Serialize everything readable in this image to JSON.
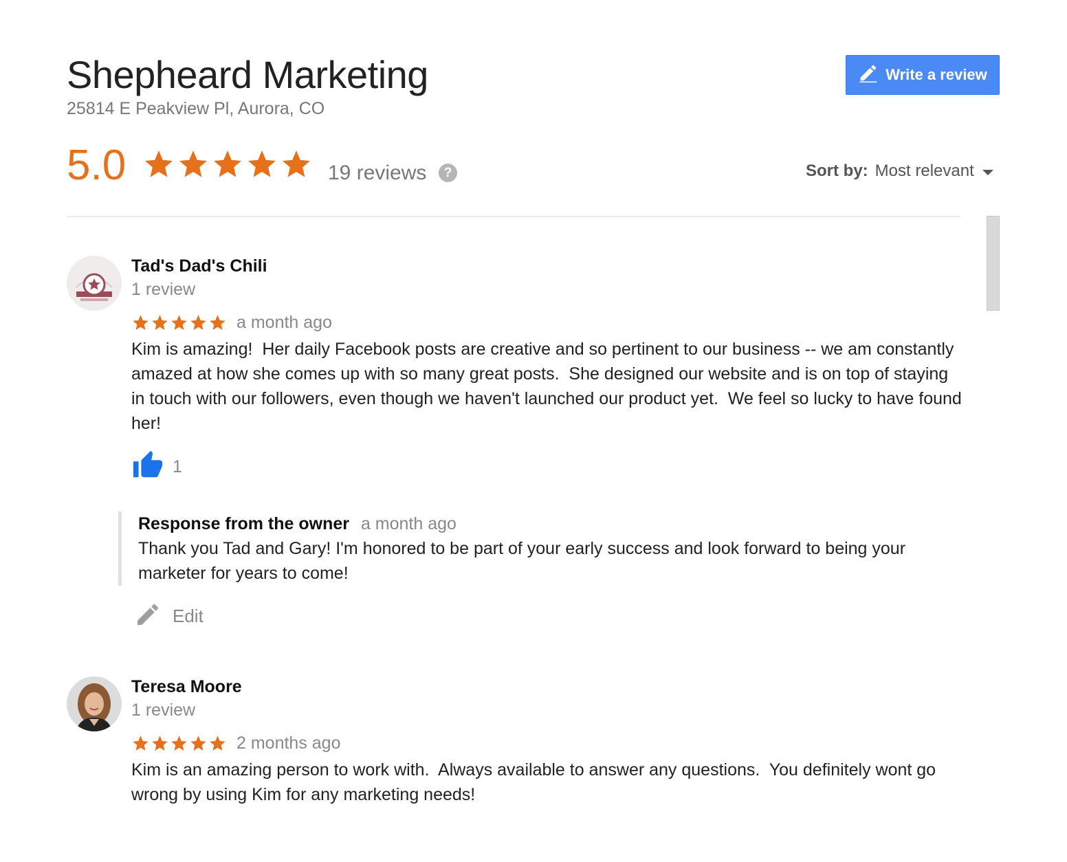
{
  "business": {
    "name": "Shepheard Marketing",
    "address": "25814 E Peakview Pl, Aurora, CO"
  },
  "write_review": {
    "label": "Write a review",
    "icon": "pencil-icon"
  },
  "rating": {
    "value": "5.0",
    "stars": 5,
    "reviews_label": "19 reviews",
    "help_glyph": "?"
  },
  "sort": {
    "label": "Sort by:",
    "value": "Most relevant"
  },
  "colors": {
    "star": "#e7711b",
    "accent": "#4a8af4",
    "like": "#1a73e8"
  },
  "reviews": [
    {
      "name": "Tad's Dad's Chili",
      "review_count": "1 review",
      "stars": 5,
      "date": "a month ago",
      "text": "Kim is amazing!  Her daily Facebook posts are creative and so pertinent to our business -- we am constantly amazed at how she comes up with so many great posts.  She designed our website and is on top of staying in touch with our followers, even though we haven't launched our product yet.  We feel so lucky to have found her!",
      "likes": "1",
      "owner_response": {
        "label": "Response from the owner",
        "date": "a month ago",
        "text": "Thank you Tad and Gary! I'm honored to be part of your early success and look forward to being your marketer for years to come!"
      },
      "edit_label": "Edit"
    },
    {
      "name": "Teresa Moore",
      "review_count": "1 review",
      "stars": 5,
      "date": "2 months ago",
      "text": "Kim is an amazing person to work with.  Always available to answer any questions.  You definitely wont go wrong by using Kim for any marketing needs!"
    }
  ]
}
